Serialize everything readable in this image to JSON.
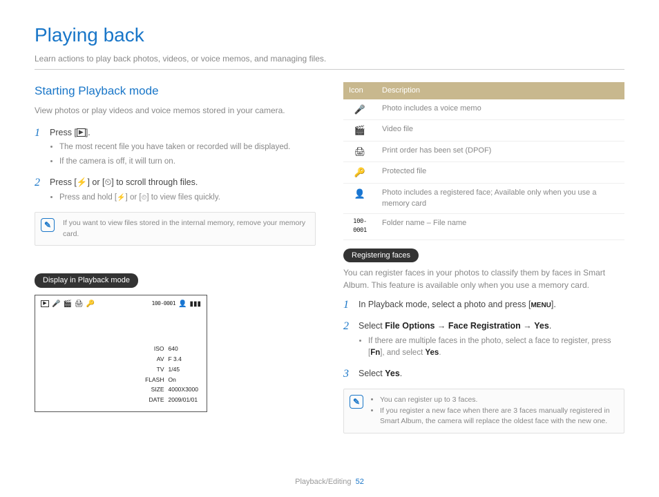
{
  "title": "Playing back",
  "subtitle": "Learn actions to play back photos, videos, or voice memos, and managing files.",
  "left": {
    "heading": "Starting Playback mode",
    "intro": "View photos or play videos and voice memos stored in your camera.",
    "step1_a": "Press [",
    "step1_b": "].",
    "step1_sub1": "The most recent file you have taken or recorded will be displayed.",
    "step1_sub2": "If the camera is off, it will turn on.",
    "step2_a": "Press [",
    "step2_b": "] or [",
    "step2_c": "] to scroll through files.",
    "step2_sub_a": "Press and hold [",
    "step2_sub_b": "] or [",
    "step2_sub_c": "] to view files quickly.",
    "note1": "If you want to view files stored in the internal memory, remove your memory card.",
    "pill": "Display in Playback mode",
    "lcd": {
      "filecount": "100-0001",
      "rows": [
        [
          "ISO",
          "640"
        ],
        [
          "AV",
          "F 3.4"
        ],
        [
          "TV",
          "1/45"
        ],
        [
          "FLASH",
          "On"
        ],
        [
          "SIZE",
          "4000X3000"
        ],
        [
          "DATE",
          "2009/01/01"
        ]
      ]
    }
  },
  "right": {
    "table_head_icon": "Icon",
    "table_head_desc": "Description",
    "rows": [
      {
        "icon": "🎤",
        "desc": "Photo includes a voice memo"
      },
      {
        "icon": "🎬",
        "desc": "Video file"
      },
      {
        "icon": "🖨",
        "desc": "Print order has been set (DPOF)"
      },
      {
        "icon": "🔑",
        "desc": "Protected file"
      },
      {
        "icon": "👤",
        "desc": "Photo includes a registered face; Available only when you use a memory card"
      },
      {
        "icon": "100-0001",
        "desc": "Folder name – File name"
      }
    ],
    "pill": "Registering faces",
    "rf_intro": "You can register faces in your photos to classify them by faces in Smart Album. This feature is available only when you use a memory card.",
    "step1_a": "In Playback mode, select a photo and press [",
    "step1_menu": "MENU",
    "step1_b": "].",
    "step2_a": "Select ",
    "step2_b1": "File Options",
    "step2_arrow": " → ",
    "step2_b2": "Face Registration",
    "step2_b3": "Yes",
    "step2_dot": ".",
    "step2_sub_a": "If there are multiple faces in the photo, select a face to register, press [",
    "step2_sub_fn": "Fn",
    "step2_sub_b": "], and select ",
    "step2_sub_yes": "Yes",
    "step2_sub_dot": ".",
    "step3_a": "Select ",
    "step3_yes": "Yes",
    "step3_dot": ".",
    "note2_li1": "You can register up to 3 faces.",
    "note2_li2": "If you register a new face when there are 3 faces manually registered in Smart Album, the camera will replace the oldest face with the new one."
  },
  "footer_section": "Playback/Editing",
  "footer_page": "52"
}
